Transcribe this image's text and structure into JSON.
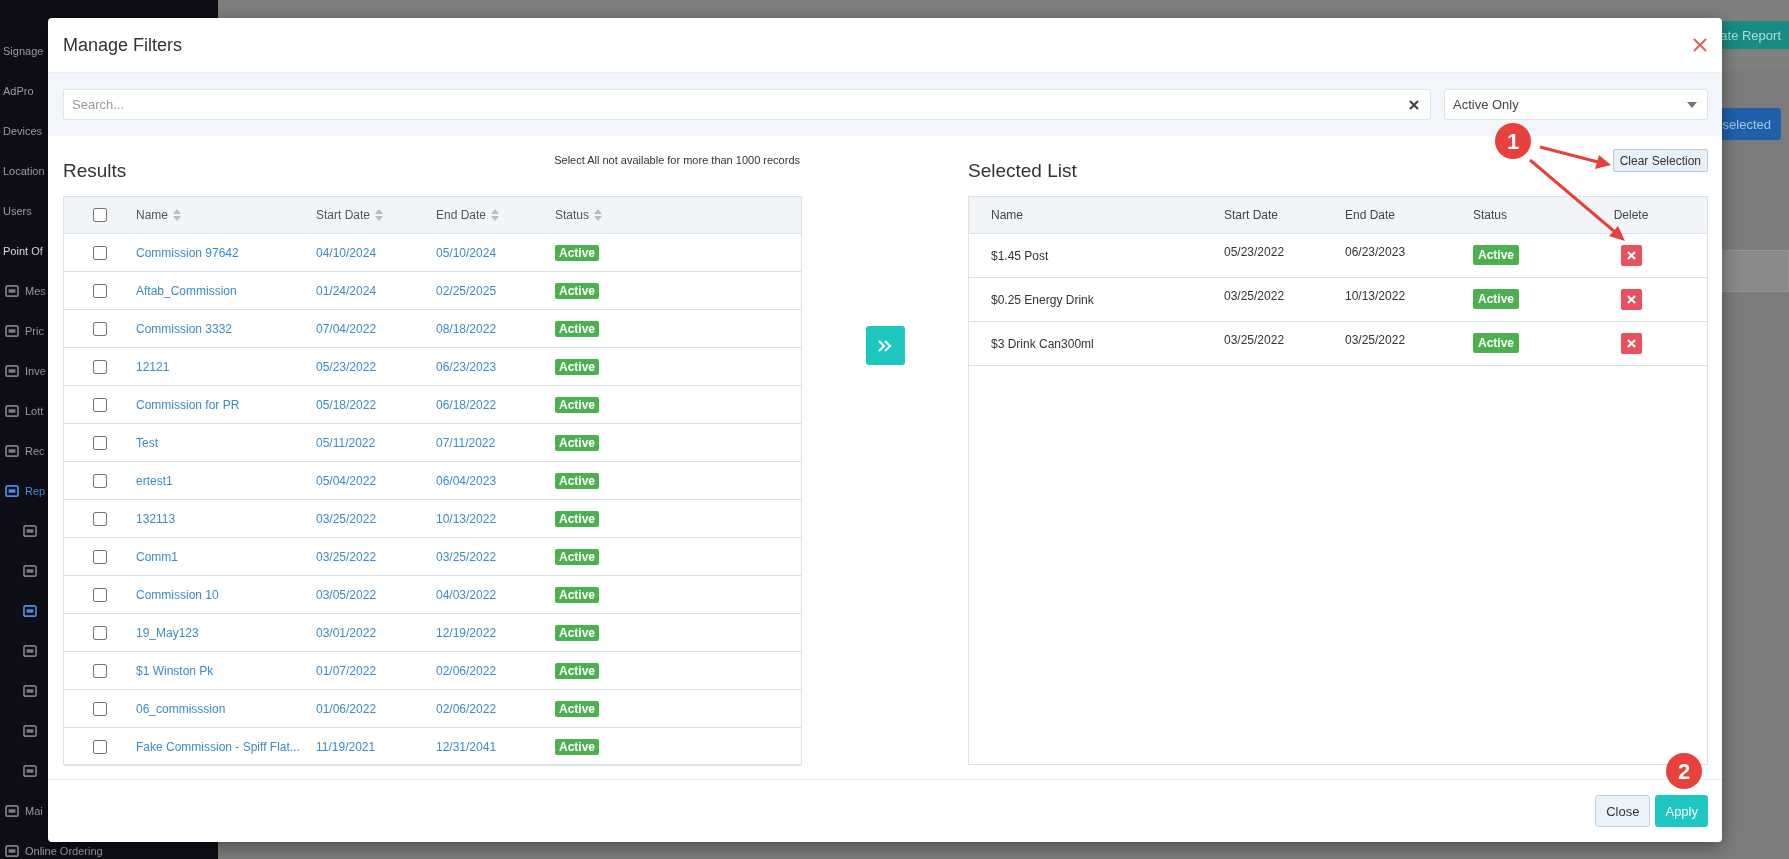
{
  "background": {
    "sidebar": [
      {
        "kind": "text",
        "label": "Signage",
        "selected": false
      },
      {
        "kind": "text",
        "label": "AdPro",
        "selected": false
      },
      {
        "kind": "text",
        "label": "Devices",
        "selected": false
      },
      {
        "kind": "text",
        "label": "Location",
        "selected": false
      },
      {
        "kind": "text",
        "label": "Users",
        "selected": false
      },
      {
        "kind": "heading",
        "label": "Point Of",
        "selected": false
      },
      {
        "kind": "icon-text",
        "label": "Mes",
        "selected": false
      },
      {
        "kind": "icon-text",
        "label": "Pric",
        "selected": false
      },
      {
        "kind": "icon-text",
        "label": "Inve",
        "selected": false
      },
      {
        "kind": "icon-text",
        "label": "Lott",
        "selected": false
      },
      {
        "kind": "icon-text",
        "label": "Rec",
        "selected": false
      },
      {
        "kind": "icon-text",
        "label": "Rep",
        "selected": true
      },
      {
        "kind": "sub-icon",
        "selected": false
      },
      {
        "kind": "sub-icon",
        "selected": false
      },
      {
        "kind": "sub-icon",
        "selected": true
      },
      {
        "kind": "sub-icon",
        "selected": false
      },
      {
        "kind": "sub-icon",
        "selected": false
      },
      {
        "kind": "sub-icon",
        "selected": false
      },
      {
        "kind": "sub-icon",
        "selected": false
      },
      {
        "kind": "icon-text",
        "label": "Mai",
        "selected": false
      },
      {
        "kind": "icon-text",
        "label": "Online Ordering",
        "selected": false
      }
    ],
    "report_button": "ate Report",
    "selected_button": "selected"
  },
  "modal": {
    "title": "Manage Filters",
    "search": {
      "placeholder": "Search..."
    },
    "status_filter": {
      "value": "Active Only"
    },
    "results": {
      "title": "Results",
      "note": "Select All not available for more than 1000 records",
      "select_all_checked": false,
      "columns": [
        "Name",
        "Start Date",
        "End Date",
        "Status"
      ],
      "rows": [
        {
          "name": "Commission 97642",
          "start": "04/10/2024",
          "end": "05/10/2024",
          "status": "Active",
          "checked": false
        },
        {
          "name": "Aftab_Commission",
          "start": "01/24/2024",
          "end": "02/25/2025",
          "status": "Active",
          "checked": false
        },
        {
          "name": "Commission 3332",
          "start": "07/04/2022",
          "end": "08/18/2022",
          "status": "Active",
          "checked": false
        },
        {
          "name": "12121",
          "start": "05/23/2022",
          "end": "06/23/2023",
          "status": "Active",
          "checked": false
        },
        {
          "name": "Commission for PR",
          "start": "05/18/2022",
          "end": "06/18/2022",
          "status": "Active",
          "checked": false
        },
        {
          "name": "Test",
          "start": "05/11/2022",
          "end": "07/11/2022",
          "status": "Active",
          "checked": false
        },
        {
          "name": "ertest1",
          "start": "05/04/2022",
          "end": "06/04/2023",
          "status": "Active",
          "checked": false
        },
        {
          "name": "132113",
          "start": "03/25/2022",
          "end": "10/13/2022",
          "status": "Active",
          "checked": false
        },
        {
          "name": "Comm1",
          "start": "03/25/2022",
          "end": "03/25/2022",
          "status": "Active",
          "checked": false
        },
        {
          "name": "Commission 10",
          "start": "03/05/2022",
          "end": "04/03/2022",
          "status": "Active",
          "checked": false
        },
        {
          "name": "19_May123",
          "start": "03/01/2022",
          "end": "12/19/2022",
          "status": "Active",
          "checked": false
        },
        {
          "name": "$1 Winston Pk",
          "start": "01/07/2022",
          "end": "02/06/2022",
          "status": "Active",
          "checked": false
        },
        {
          "name": "06_commisssion",
          "start": "01/06/2022",
          "end": "02/06/2022",
          "status": "Active",
          "checked": false
        },
        {
          "name": "Fake Commission - Spiff Flat...",
          "start": "11/19/2021",
          "end": "12/31/2041",
          "status": "Active",
          "checked": false
        }
      ]
    },
    "selected_list": {
      "title": "Selected List",
      "clear_button": "Clear Selection",
      "columns": [
        "Name",
        "Start Date",
        "End Date",
        "Status",
        "Delete"
      ],
      "rows": [
        {
          "name": "$1.45 Post",
          "start": "05/23/2022",
          "end": "06/23/2023",
          "status": "Active"
        },
        {
          "name": "$0.25 Energy Drink",
          "start": "03/25/2022",
          "end": "10/13/2022",
          "status": "Active"
        },
        {
          "name": "$3 Drink Can300ml",
          "start": "03/25/2022",
          "end": "03/25/2022",
          "status": "Active"
        }
      ]
    },
    "footer": {
      "buttons": [
        "Close",
        "Apply"
      ]
    }
  },
  "annotations": [
    {
      "label": "1"
    },
    {
      "label": "2"
    }
  ]
}
